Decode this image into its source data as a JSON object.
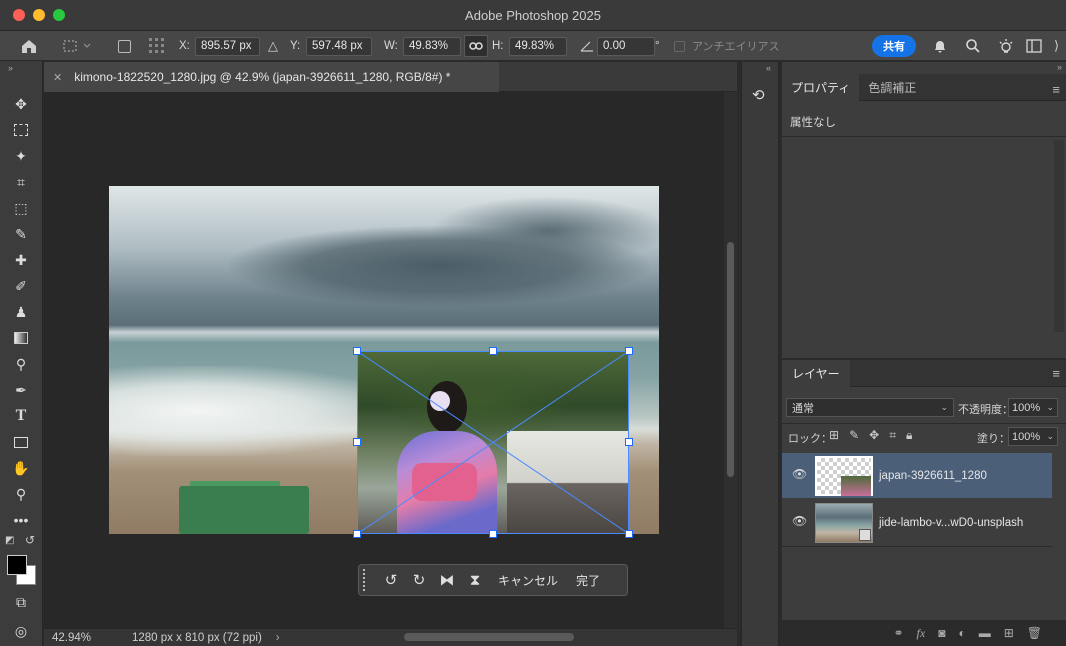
{
  "window": {
    "title": "Adobe Photoshop 2025"
  },
  "options_bar": {
    "x_label": "X:",
    "x_value": "895.57 px",
    "y_label": "Y:",
    "y_value": "597.48 px",
    "w_label": "W:",
    "w_value": "49.83%",
    "h_label": "H:",
    "h_value": "49.83%",
    "angle_value": "0.00",
    "angle_unit": "°",
    "antialias_label": "アンチエイリアス",
    "share_label": "共有"
  },
  "document": {
    "tab_title": "kimono-1822520_1280.jpg @ 42.9% (japan-3926611_1280, RGB/8#) *",
    "zoom": "42.94%",
    "dimensions": "1280 px x 810 px (72 ppi)"
  },
  "context_bar": {
    "cancel_label": "キャンセル",
    "done_label": "完了"
  },
  "properties_panel": {
    "tab_properties": "プロパティ",
    "tab_adjustments": "色調補正",
    "status_text": "属性なし"
  },
  "layers_panel": {
    "tab_label": "レイヤー",
    "blend_mode": "通常",
    "opacity_label": "不透明度：",
    "opacity_value": "100%",
    "lock_label": "ロック：",
    "fill_label": "塗り：",
    "fill_value": "100%",
    "layers": [
      {
        "name": "japan-3926611_1280",
        "selected": true
      },
      {
        "name": "jide-lambo-v...wD0-unsplash",
        "selected": false
      }
    ]
  },
  "colors": {
    "accent": "#1473e6",
    "selection": "#4a8bff",
    "selected_layer": "#4b5f78"
  }
}
